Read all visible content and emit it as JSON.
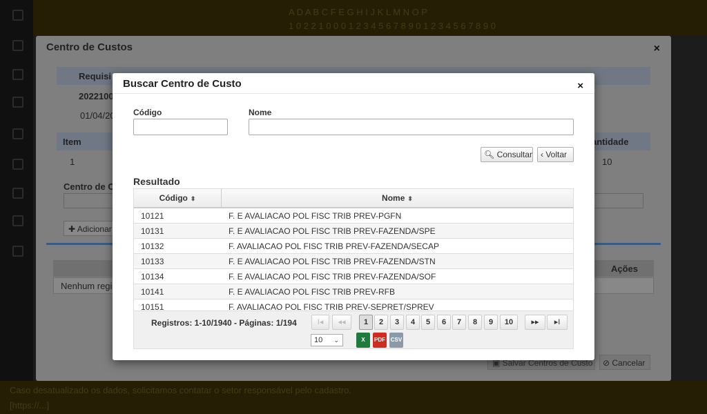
{
  "background": {
    "topbar_line1": "A D A B C F E G H I J K L M N O P",
    "topbar_line2": "1 0 2 2 1 0 0 0 1 2 3 4 5 6 7 8 9 0 1 2 3 4 5 6 7 8 9 0",
    "bottombar_line1": "Caso desatualizado os dados, solicitamos contatar o setor responsável pelo cadastro.",
    "bottombar_line2": "[https://...]"
  },
  "modal_centro": {
    "title": "Centro de Custos",
    "close": "×",
    "requisicao_label": "Requisi",
    "requisicao_value": "2022100",
    "date": "01/04/20",
    "item_header": "Item",
    "quantidade_header": "antidade",
    "item_value": "1",
    "quantidade_value": "10",
    "centro_label": "Centro de Cu",
    "add_button": "✚ Adicionar",
    "acoes_header": "Ações",
    "empty_text": "Nenhum regis",
    "save_button": "Salvar Centros de Custo",
    "cancel_button": "Cancelar"
  },
  "modal_busca": {
    "title": "Buscar Centro de Custo",
    "close": "×",
    "codigo_label": "Código",
    "codigo_value": "",
    "nome_label": "Nome",
    "nome_value": "",
    "consultar_label": "Consultar",
    "voltar_label": "Voltar",
    "resultado_label": "Resultado",
    "columns": [
      "Código",
      "Nome"
    ],
    "rows": [
      {
        "codigo": "10121",
        "nome": "F. E AVALIACAO POL FISC TRIB PREV-PGFN"
      },
      {
        "codigo": "10131",
        "nome": "F. E AVALIACAO POL FISC TRIB PREV-FAZENDA/SPE"
      },
      {
        "codigo": "10132",
        "nome": "F. AVALIACAO POL FISC TRIB PREV-FAZENDA/SECAP"
      },
      {
        "codigo": "10133",
        "nome": "F. E AVALIACAO POL FISC TRIB PREV-FAZENDA/STN"
      },
      {
        "codigo": "10134",
        "nome": "F. E AVALIACAO POL FISC TRIB PREV-FAZENDA/SOF"
      },
      {
        "codigo": "10141",
        "nome": "F. E AVALIACAO POL FISC TRIB PREV-RFB"
      },
      {
        "codigo": "10151",
        "nome": "F. AVALIACAO POL FISC TRIB PREV-SEPRET/SPREV"
      }
    ],
    "registros": "Registros: 1-10/1940 - Páginas: 1/194",
    "pager": {
      "first": "I◂",
      "prev": "◂◂",
      "pages": [
        "1",
        "2",
        "3",
        "4",
        "5",
        "6",
        "7",
        "8",
        "9",
        "10"
      ],
      "next": "▸▸",
      "last": "▸I",
      "current_page": "1"
    },
    "page_size": "10",
    "export": {
      "xls": "X",
      "pdf": "PDF",
      "csv": "CSV"
    }
  },
  "colors": {
    "accent": "#395c86",
    "excel": "#1f7a3e",
    "pdf": "#d12a1f"
  }
}
